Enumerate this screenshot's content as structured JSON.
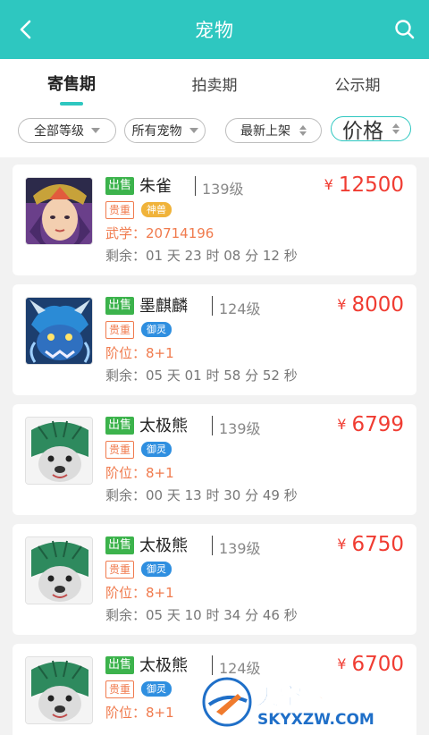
{
  "header": {
    "title": "宠物",
    "back_icon": "chevron-left-icon",
    "search_icon": "search-icon",
    "bg_color": "#2ec7c0"
  },
  "tabs": [
    {
      "label": "寄售期",
      "active": true
    },
    {
      "label": "拍卖期",
      "active": false
    },
    {
      "label": "公示期",
      "active": false
    }
  ],
  "filters": {
    "level": "全部等级",
    "pet": "所有宠物",
    "latest": "最新上架",
    "price": "价格"
  },
  "items": [
    {
      "sell": "出售",
      "name": "朱雀",
      "level": "139级",
      "currency": "¥",
      "price": "12500",
      "rare": "贵重",
      "type": "神兽",
      "type_color": "#f0b33a",
      "attr": "武学：20714196",
      "remaining": "剩余：01 天 23 时 08 分 12 秒"
    },
    {
      "sell": "出售",
      "name": "墨麒麟",
      "level": "124级",
      "currency": "¥",
      "price": "8000",
      "rare": "贵重",
      "type": "御灵",
      "type_color": "#2f8fe0",
      "attr": "阶位：8+1",
      "remaining": "剩余：05 天 01 时 58 分 52 秒"
    },
    {
      "sell": "出售",
      "name": "太极熊",
      "level": "139级",
      "currency": "¥",
      "price": "6799",
      "rare": "贵重",
      "type": "御灵",
      "type_color": "#2f8fe0",
      "attr": "阶位：8+1",
      "remaining": "剩余：00 天 13 时 30 分 49 秒"
    },
    {
      "sell": "出售",
      "name": "太极熊",
      "level": "139级",
      "currency": "¥",
      "price": "6750",
      "rare": "贵重",
      "type": "御灵",
      "type_color": "#2f8fe0",
      "attr": "阶位：8+1",
      "remaining": "剩余：05 天 10 时 34 分 46 秒"
    },
    {
      "sell": "出售",
      "name": "太极熊",
      "level": "124级",
      "currency": "¥",
      "price": "6700",
      "rare": "贵重",
      "type": "御灵",
      "type_color": "#2f8fe0",
      "attr": "阶位：8+1",
      "remaining": ""
    }
  ],
  "watermark": {
    "text": "天空下载玩",
    "sub": "SKYXZW.COM"
  }
}
